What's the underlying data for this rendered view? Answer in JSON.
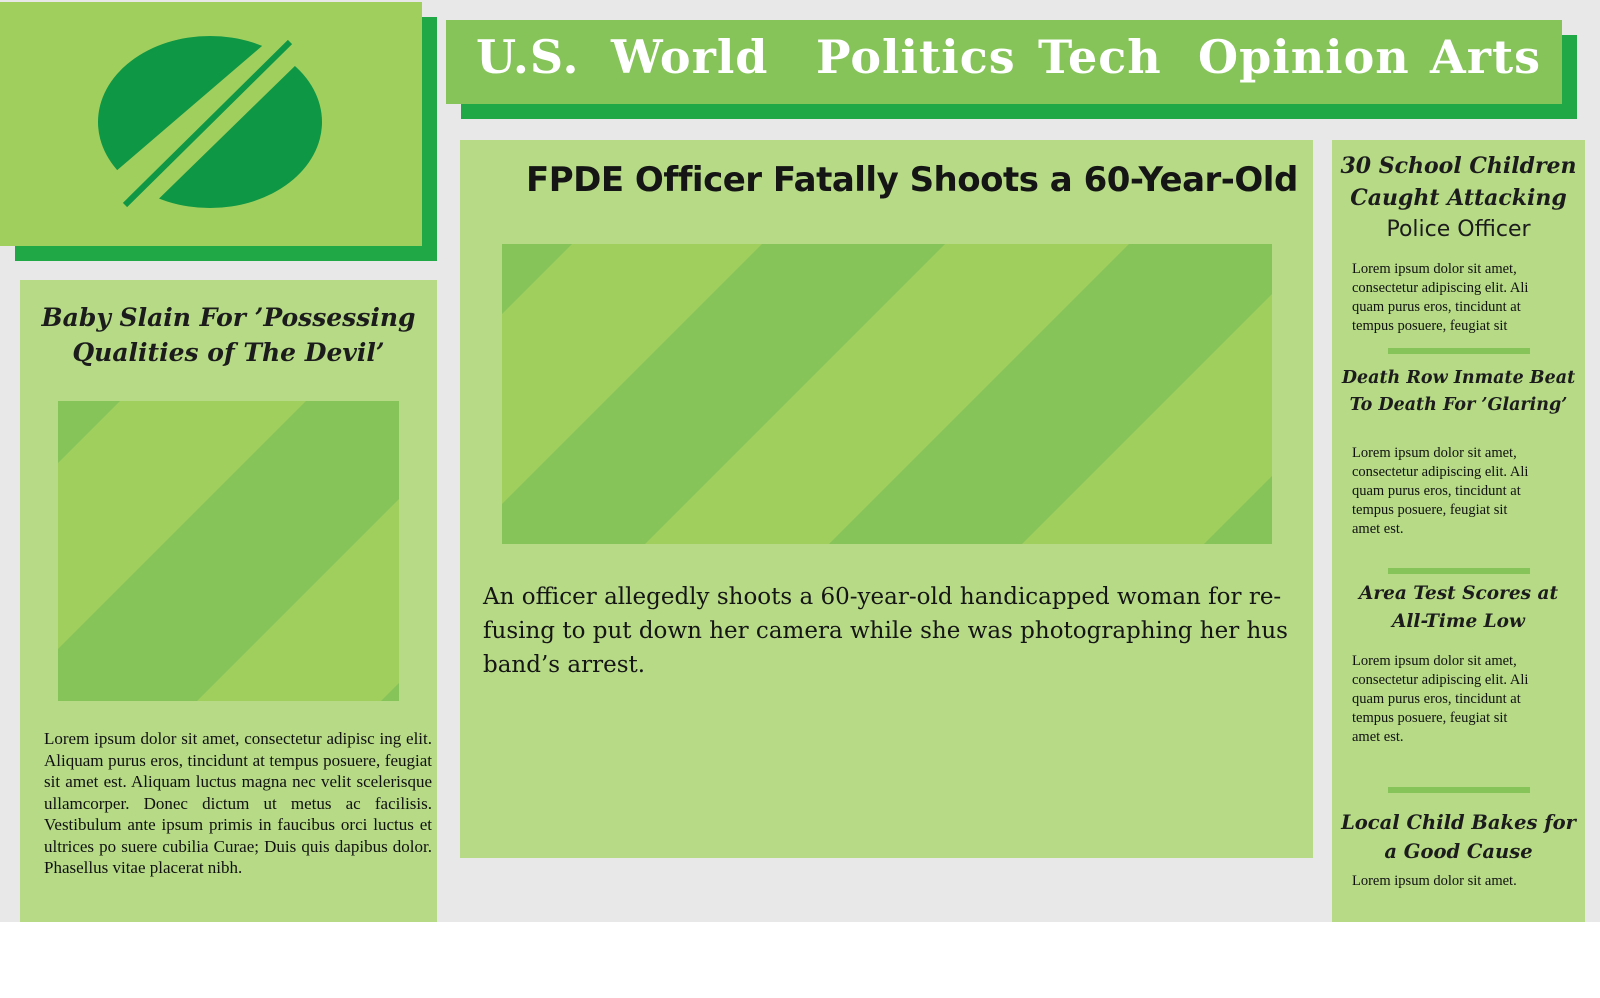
{
  "nav": {
    "items": [
      "U.S.",
      "World",
      "Politics",
      "Tech",
      "Opinion",
      "Arts"
    ]
  },
  "left_story": {
    "title_lines": [
      "Baby Slain For ’Possessing",
      "Qualities of The Devil’"
    ],
    "body": "Lorem ipsum dolor sit amet, consectetur adipisc ing elit. Aliquam purus eros, tincidunt at tempus posuere, feugiat sit amet est. Aliquam luctus magna nec velit scelerisque ullamcorper. Donec dictum ut metus ac facilisis. Vestibulum ante ipsum primis in faucibus orci luctus et ultrices po suere cubilia Curae; Duis quis dapibus dolor. Phasellus vitae placerat nibh."
  },
  "main_story": {
    "title": "FPDE Officer Fatally Shoots a 60-Year-Old",
    "body_lines": [
      "An officer allegedly shoots a 60-year-old handicapped woman for re-",
      "fusing to put down her camera while she was photographing her hus",
      "band’s arrest."
    ]
  },
  "side_stories": [
    {
      "title_lines": [
        "30 School Children",
        "Caught Attacking"
      ],
      "title_tail": "Police Officer",
      "body_lines": [
        "Lorem ipsum dolor sit amet,",
        "consectetur adipiscing elit. Ali",
        "quam purus eros, tincidunt at",
        "tempus posuere, feugiat sit"
      ]
    },
    {
      "title_lines": [
        "Death Row Inmate Beat",
        "To Death For ’Glaring’"
      ],
      "body_lines": [
        "Lorem ipsum dolor sit amet,",
        "consectetur adipiscing elit. Ali",
        "quam purus eros, tincidunt at",
        "tempus posuere, feugiat sit",
        "amet est."
      ]
    },
    {
      "title_lines": [
        "Area Test Scores at",
        "All-Time Low"
      ],
      "body_lines": [
        "Lorem ipsum dolor sit amet,",
        "consectetur adipiscing elit. Ali",
        "quam purus eros, tincidunt at",
        "tempus posuere, feugiat sit",
        "amet est."
      ]
    },
    {
      "title_lines": [
        "Local Child Bakes for",
        "a Good Cause"
      ],
      "body_lines": [
        "Lorem ipsum dolor sit amet."
      ]
    }
  ],
  "colors": {
    "page_bg": "#e8e8e8",
    "logo_panel": "#a1cf5e",
    "accent_dark": "#1fa845",
    "logo_mark": "#0e9744",
    "nav_bg": "#86c45a",
    "card_bg": "#b6da86",
    "stripe_dark": "#86c45a",
    "stripe_light": "#a1cf5e"
  }
}
